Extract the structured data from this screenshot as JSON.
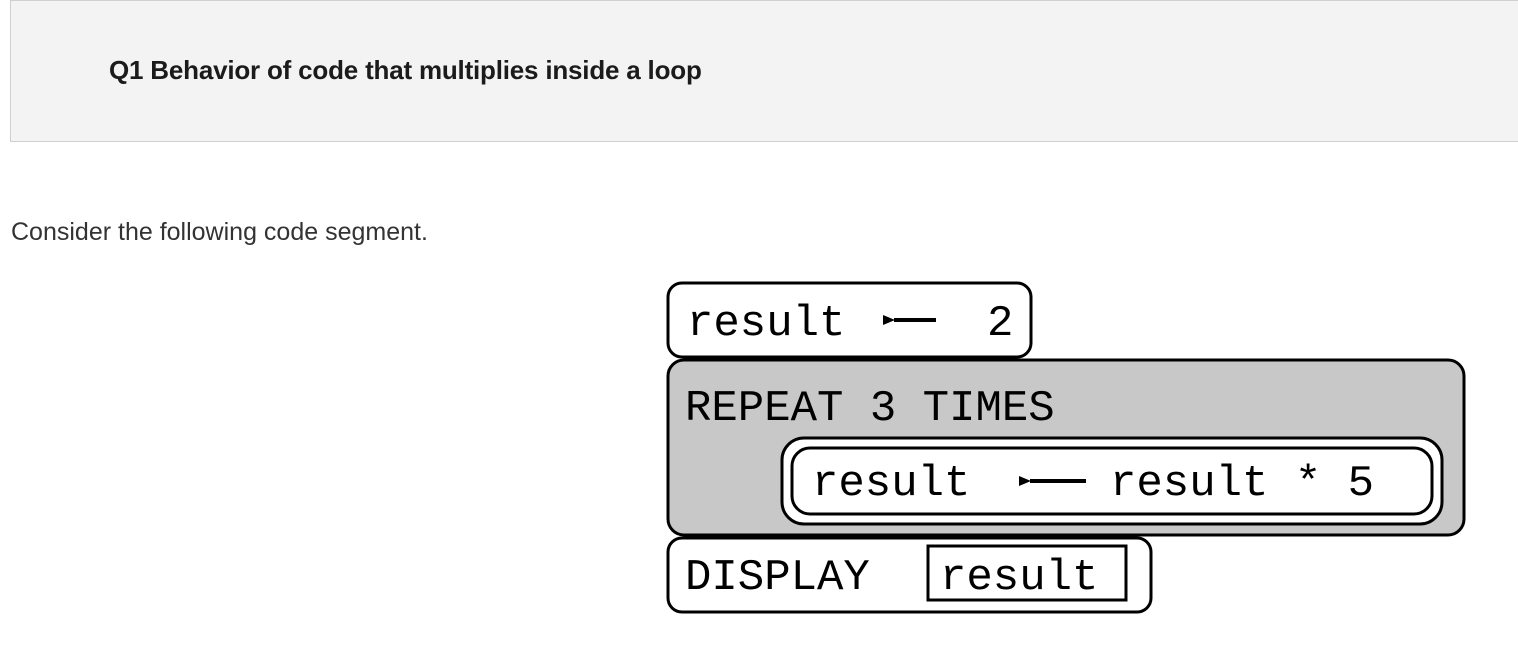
{
  "question": {
    "title": "Q1 Behavior of code that multiplies inside a loop"
  },
  "prompt": {
    "text": "Consider the following code segment."
  },
  "code": {
    "line1": {
      "variable": "result",
      "value": "2"
    },
    "repeat_block": {
      "header": "REPEAT 3 TIMES",
      "body": {
        "variable": "result",
        "expression": "result * 5"
      }
    },
    "display_block": {
      "keyword": "DISPLAY",
      "argument": "result"
    }
  },
  "colors": {
    "header_background": "#f3f3f3",
    "repeat_block_fill": "#c8c8c8",
    "block_stroke": "#000000"
  }
}
